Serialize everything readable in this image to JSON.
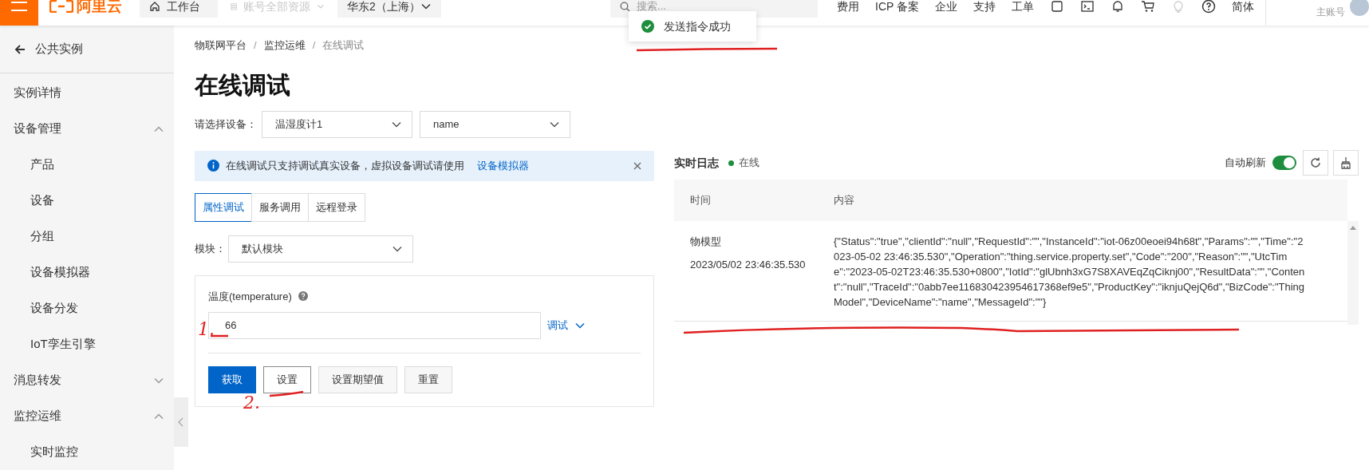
{
  "topbar": {
    "logo": "阿里云",
    "workbench": "工作台",
    "resources": {
      "label": "账号全部资源",
      "disabled": true
    },
    "region": "华东2（上海）",
    "search": {
      "placeholder": "搜索..."
    },
    "links": [
      "费用",
      "ICP 备案",
      "企业",
      "支持",
      "工单"
    ],
    "language": "简体",
    "user": {
      "role": "主账号"
    }
  },
  "toast": {
    "message": "发送指令成功"
  },
  "sidebar": {
    "back": "公共实例",
    "items": [
      {
        "label": "实例详情",
        "kind": "item"
      },
      {
        "label": "设备管理",
        "kind": "group",
        "expanded": true
      },
      {
        "label": "产品",
        "kind": "subitem"
      },
      {
        "label": "设备",
        "kind": "subitem"
      },
      {
        "label": "分组",
        "kind": "subitem"
      },
      {
        "label": "设备模拟器",
        "kind": "subitem"
      },
      {
        "label": "设备分发",
        "kind": "subitem"
      },
      {
        "label": "IoT孪生引擎",
        "kind": "subitem"
      },
      {
        "label": "消息转发",
        "kind": "group",
        "expanded": false
      },
      {
        "label": "监控运维",
        "kind": "group",
        "expanded": true
      },
      {
        "label": "实时监控",
        "kind": "subitem"
      }
    ]
  },
  "breadcrumb": {
    "items": [
      "物联网平台",
      "监控运维",
      "在线调试"
    ],
    "separator": "/"
  },
  "title": "在线调试",
  "device": {
    "label": "请选择设备：",
    "product": "温湿度计1",
    "name": "name"
  },
  "alert": {
    "text": "在线调试只支持调试真实设备，虚拟设备调试请使用",
    "link": "设备模拟器"
  },
  "tabs": [
    {
      "label": "属性调试",
      "selected": true
    },
    {
      "label": "服务调用",
      "selected": false
    },
    {
      "label": "远程登录",
      "selected": false
    }
  ],
  "module": {
    "label": "模块：",
    "value": "默认模块"
  },
  "property": {
    "label": "温度(temperature)",
    "value": "66",
    "debug": "调试"
  },
  "buttons": [
    {
      "label": "获取",
      "kind": "primary"
    },
    {
      "label": "设置",
      "kind": "focused"
    },
    {
      "label": "设置期望值",
      "kind": "default"
    },
    {
      "label": "重置",
      "kind": "default"
    }
  ],
  "annotations": [
    "1.",
    "2."
  ],
  "log": {
    "title": "实时日志",
    "status": "在线",
    "auto_refresh": {
      "label": "自动刷新",
      "on": true
    },
    "columns": [
      "时间",
      "内容"
    ],
    "rows": [
      {
        "type": "物模型",
        "time": "2023/05/02 23:46:35.530",
        "content": "{\"Status\":\"true\",\"clientId\":\"null\",\"RequestId\":\"\",\"InstanceId\":\"iot-06z00eoei94h68t\",\"Params\":\"\",\"Time\":\"2023-05-02 23:46:35.530\",\"Operation\":\"thing.service.property.set\",\"Code\":\"200\",\"Reason\":\"\",\"UtcTime\":\"2023-05-02T23:46:35.530+0800\",\"IotId\":\"glUbnh3xG7S8XAVEqZqCiknj00\",\"ResultData\":\"\",\"Content\":\"null\",\"TraceId\":\"0abb7ee116830423954617368ef9e5\",\"ProductKey\":\"iknjuQejQ6d\",\"BizCode\":\"ThingModel\",\"DeviceName\":\"name\",\"MessageId\":\"\"}"
      }
    ]
  }
}
